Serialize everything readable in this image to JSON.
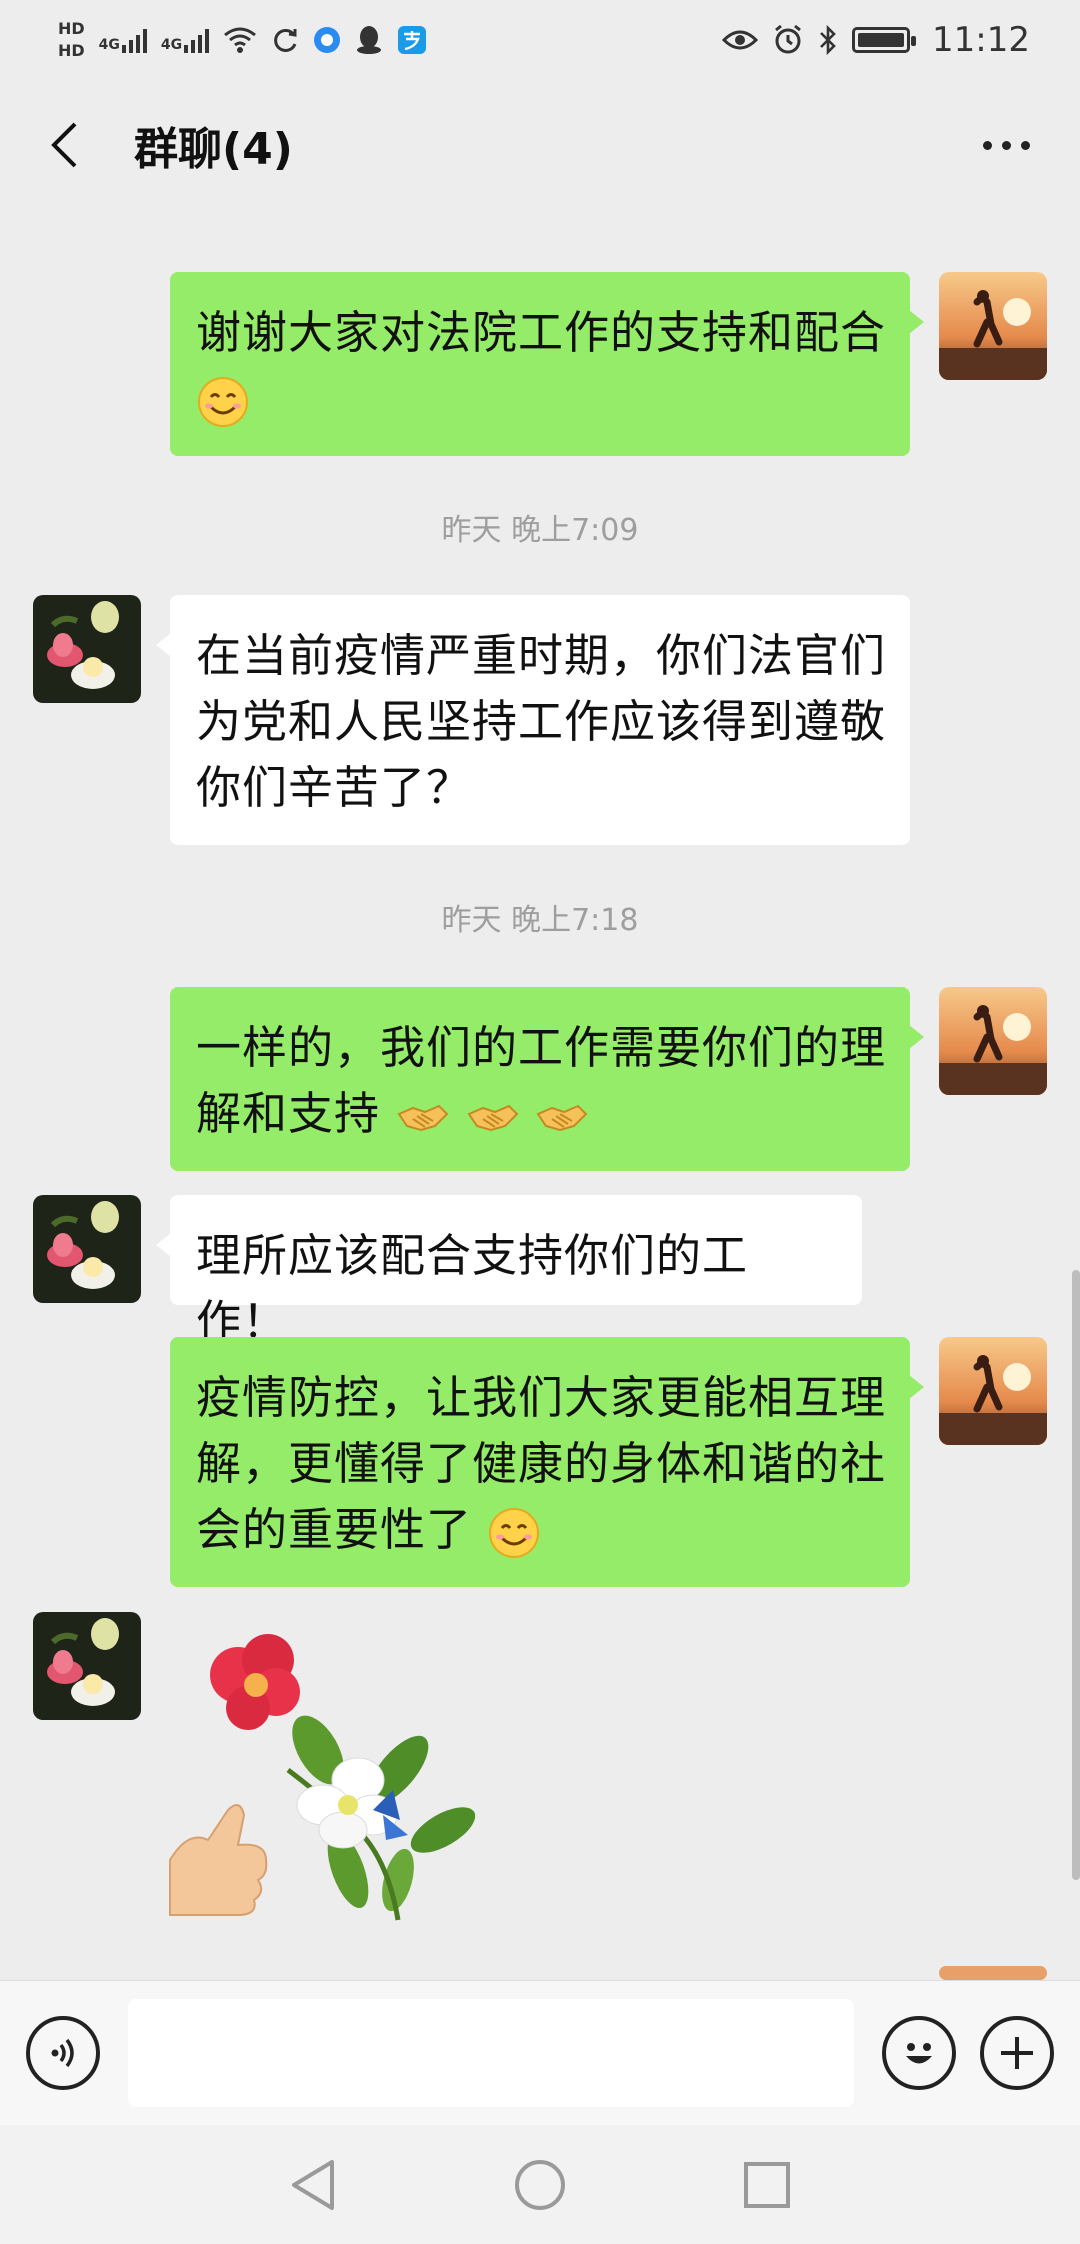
{
  "status_bar": {
    "hd1": "HD",
    "hd2": "HD",
    "net1": "4G",
    "net2": "4G",
    "time": "11:12"
  },
  "header": {
    "title": "群聊(4)"
  },
  "messages": [
    {
      "side": "me",
      "text": "谢谢大家对法院工作的支持和配合"
    },
    {
      "timestamp": "昨天 晚上7:09"
    },
    {
      "side": "them",
      "line1": "在当前疫情严重时期，你们法官们",
      "line2": "为党和人民坚持工作应该得到遵敬",
      "line3": "你们辛苦了？"
    },
    {
      "timestamp": "昨天 晚上7:18"
    },
    {
      "side": "me",
      "line1": "一样的，我们的工作需要你们的理",
      "line2": "解和支持"
    },
    {
      "side": "them",
      "text": "理所应该配合支持你们的工作！"
    },
    {
      "side": "me",
      "line1": "疫情防控，让我们大家更能相互理",
      "line2": "解，更懂得了健康的身体和谐的社",
      "line3": "会的重要性了"
    },
    {
      "side": "them",
      "sticker": "flower-thumbs-up-sticker"
    }
  ],
  "input": {
    "value": "",
    "placeholder": ""
  },
  "colors": {
    "my_bubble": "#95ec69",
    "their_bubble": "#ffffff",
    "background": "#ededed"
  }
}
